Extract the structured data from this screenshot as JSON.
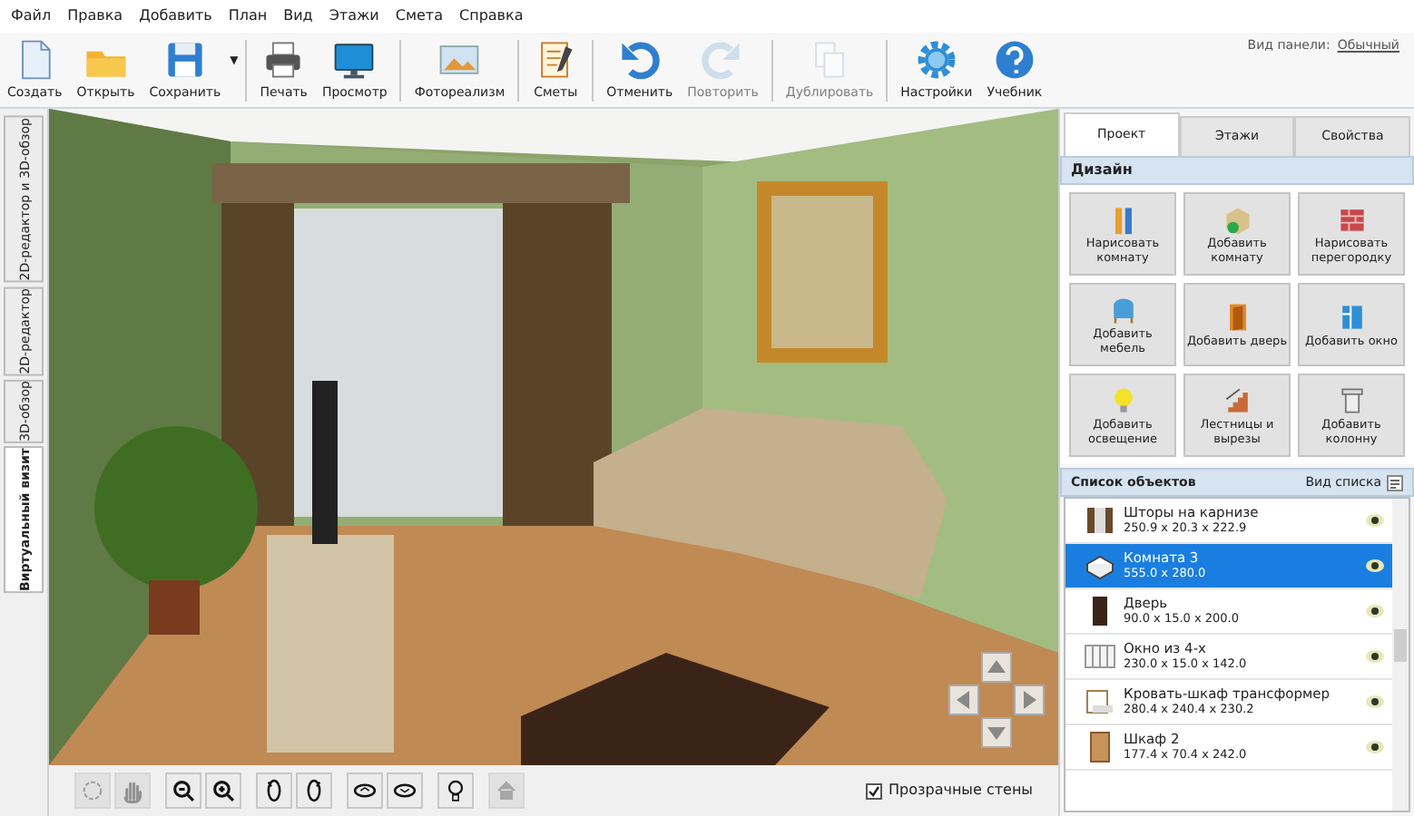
{
  "menu": [
    "Файл",
    "Правка",
    "Добавить",
    "План",
    "Вид",
    "Этажи",
    "Смета",
    "Справка"
  ],
  "toolbar": {
    "groups": [
      [
        {
          "label": "Создать",
          "disabled": false
        },
        {
          "label": "Открыть",
          "disabled": false
        },
        {
          "label": "Сохранить",
          "disabled": false,
          "dropdown": "▼"
        }
      ],
      [
        {
          "label": "Печать",
          "disabled": false
        },
        {
          "label": "Просмотр",
          "disabled": false
        }
      ],
      [
        {
          "label": "Фотореализм",
          "disabled": false
        }
      ],
      [
        {
          "label": "Сметы",
          "disabled": false
        }
      ],
      [
        {
          "label": "Отменить",
          "disabled": false
        },
        {
          "label": "Повторить",
          "disabled": true
        }
      ],
      [
        {
          "label": "Дублировать",
          "disabled": true
        }
      ],
      [
        {
          "label": "Настройки",
          "disabled": false
        },
        {
          "label": "Учебник",
          "disabled": false
        }
      ]
    ],
    "panel_view_label": "Вид панели:",
    "panel_view_value": "Обычный"
  },
  "side_tabs": [
    {
      "label": "2D-редактор и 3D-обзор",
      "selected": false
    },
    {
      "label": "2D-редактор",
      "selected": false
    },
    {
      "label": "3D-обзор",
      "selected": false
    },
    {
      "label": "Виртуальный визит",
      "selected": true
    }
  ],
  "viewport_tools": [
    {
      "disabled": true
    },
    {
      "disabled": true
    },
    {
      "disabled": false
    },
    {
      "disabled": false
    },
    {
      "disabled": false
    },
    {
      "disabled": false
    },
    {
      "disabled": false
    },
    {
      "disabled": false
    },
    {
      "disabled": false
    },
    {
      "disabled": true
    }
  ],
  "transparent_walls": {
    "label": "Прозрачные стены",
    "checked": true
  },
  "right_panel": {
    "tabs": [
      {
        "label": "Проект",
        "selected": true
      },
      {
        "label": "Этажи",
        "selected": false
      },
      {
        "label": "Свойства",
        "selected": false
      }
    ],
    "design_title": "Дизайн",
    "design_buttons": [
      "Нарисовать комнату",
      "Добавить комнату",
      "Нарисовать перегородку",
      "Добавить мебель",
      "Добавить дверь",
      "Добавить окно",
      "Добавить освещение",
      "Лестницы и вырезы",
      "Добавить колонну"
    ],
    "objects_title": "Список объектов",
    "list_view_label": "Вид списка",
    "objects": [
      {
        "name": "Шторы на карнизе",
        "size": "250.9 x 20.3 x 222.9",
        "selected": false,
        "visible": true
      },
      {
        "name": "Комната 3",
        "size": "555.0 x 280.0",
        "selected": true,
        "visible": true
      },
      {
        "name": "Дверь",
        "size": "90.0 x 15.0 x 200.0",
        "selected": false,
        "visible": true
      },
      {
        "name": "Окно из 4-х",
        "size": "230.0 x 15.0 x 142.0",
        "selected": false,
        "visible": true
      },
      {
        "name": "Кровать-шкаф трансформер",
        "size": "280.4 x 240.4 x 230.2",
        "selected": false,
        "visible": true
      },
      {
        "name": "Шкаф 2",
        "size": "177.4 x 70.4 x 242.0",
        "selected": false,
        "visible": true
      }
    ]
  }
}
